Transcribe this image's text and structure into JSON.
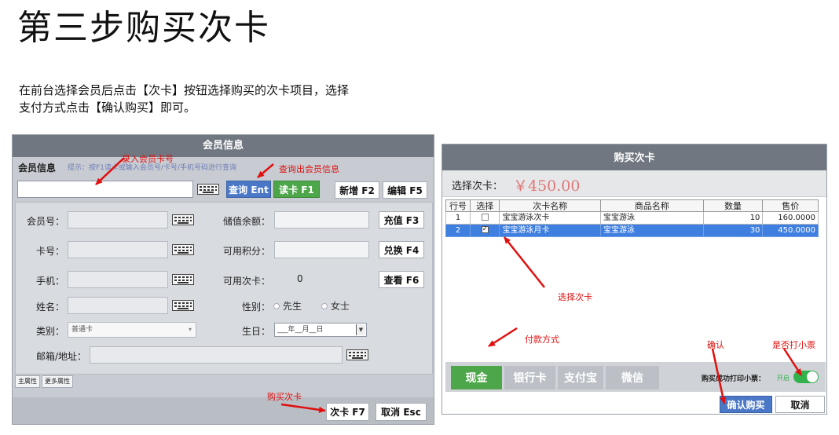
{
  "page": {
    "title": "第三步购买次卡",
    "description_lines": [
      "在前台选择会员后点击【次卡】按钮选择购买的次卡项目，选择",
      "支付方式点击【确认购买】即可。"
    ]
  },
  "member_panel": {
    "header": "会员信息",
    "section_label": "会员信息",
    "hint": "提示：按F1读卡或输入会员号/卡号/手机号码进行查询",
    "search_button": "查询 Ent",
    "read_card_button": "读卡 F1",
    "new_button": "新增 F2",
    "edit_button": "编辑 F5",
    "fields": {
      "member_no": "会员号：",
      "card_no": "卡号：",
      "phone": "手机：",
      "name": "姓名：",
      "category": "类别：",
      "email_address": "邮箱/地址："
    },
    "category_value": "普通卡",
    "balance_label": "储值余额：",
    "points_label": "可用积分：",
    "times_label": "可用次卡：",
    "times_value": "0",
    "gender_label": "性别：",
    "gender_options": [
      "先生",
      "女士"
    ],
    "birthday_label": "生日：",
    "birthday_placeholder": "___年__月__日",
    "recharge_button": "充值 F3",
    "exchange_button": "兑换 F4",
    "view_button": "查看 F6",
    "tabs": [
      "主属性",
      "更多属性"
    ],
    "buy_card_button": "次卡 F7",
    "cancel_button": "取消 Esc"
  },
  "buy_panel": {
    "header": "购买次卡",
    "select_label": "选择次卡：",
    "price": "￥450.00",
    "columns": [
      "行号",
      "选择",
      "次卡名称",
      "商品名称",
      "数量",
      "售价"
    ],
    "rows": [
      {
        "no": "1",
        "checked": false,
        "card_name": "宝宝游泳次卡",
        "product": "宝宝游泳",
        "qty": "10",
        "price": "160.0000",
        "selected": false
      },
      {
        "no": "2",
        "checked": true,
        "card_name": "宝宝游泳月卡",
        "product": "宝宝游泳",
        "qty": "30",
        "price": "450.0000",
        "selected": true
      }
    ],
    "pay_methods": [
      "现金",
      "银行卡",
      "支付宝",
      "微信"
    ],
    "print_label": "购买成功打印小票：",
    "toggle_text": "开启",
    "confirm_button": "确认购买",
    "cancel_button": "取消"
  },
  "annotations": {
    "enter_card": "录入会员卡号",
    "query_info": "查询出会员信息",
    "buy_card": "购买次卡",
    "select_card": "选择次卡",
    "payment": "付款方式",
    "confirm": "确认",
    "print_receipt": "是否打小票"
  },
  "colors": {
    "annotation_red": "#e01010",
    "header_gray": "#707780",
    "accent_blue": "#4a78c6",
    "accent_green": "#4ea64a",
    "toggle_green": "#31b24b",
    "selected_row": "#3f7fe0",
    "price_red": "#e07777"
  },
  "icons": [
    "keyboard-icon",
    "dropdown-caret-icon",
    "checkbox-icon",
    "radio-icon",
    "toggle-switch-icon",
    "arrow-icon"
  ]
}
